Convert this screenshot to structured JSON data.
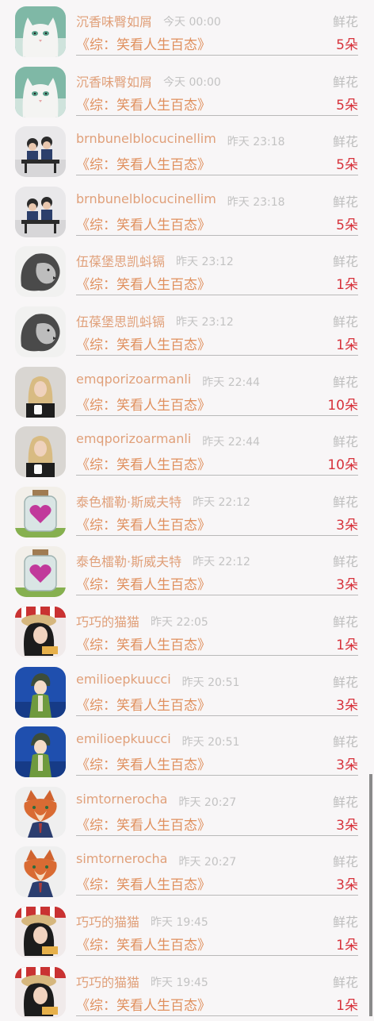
{
  "rows": [
    {
      "name": "沉香味臀如屑",
      "time": "今天 00:00",
      "gift": "鲜花",
      "book": "《综：笑看人生百态》",
      "count": "5朵",
      "avatar": "white-cat"
    },
    {
      "name": "沉香味臀如屑",
      "time": "今天 00:00",
      "gift": "鲜花",
      "book": "《综：笑看人生百态》",
      "count": "5朵",
      "avatar": "white-cat"
    },
    {
      "name": "brnbunelblocucinellim",
      "time": "昨天 23:18",
      "gift": "鲜花",
      "book": "《综：笑看人生百态》",
      "count": "5朵",
      "avatar": "kids-classroom"
    },
    {
      "name": "brnbunelblocucinellim",
      "time": "昨天 23:18",
      "gift": "鲜花",
      "book": "《综：笑看人生百态》",
      "count": "5朵",
      "avatar": "kids-classroom"
    },
    {
      "name": "伍葆堡思凯蚪镉",
      "time": "昨天 23:12",
      "gift": "鲜花",
      "book": "《综：笑看人生百态》",
      "count": "1朵",
      "avatar": "lion-sketch"
    },
    {
      "name": "伍葆堡思凯蚪镉",
      "time": "昨天 23:12",
      "gift": "鲜花",
      "book": "《综：笑看人生百态》",
      "count": "1朵",
      "avatar": "lion-sketch"
    },
    {
      "name": "emqporizoarmanli",
      "time": "昨天 22:44",
      "gift": "鲜花",
      "book": "《综：笑看人生百态》",
      "count": "10朵",
      "avatar": "blonde-woman"
    },
    {
      "name": "emqporizoarmanli",
      "time": "昨天 22:44",
      "gift": "鲜花",
      "book": "《综：笑看人生百态》",
      "count": "10朵",
      "avatar": "blonde-woman"
    },
    {
      "name": "泰色檑勒·斯威夫特",
      "time": "昨天 22:12",
      "gift": "鲜花",
      "book": "《综：笑看人生百态》",
      "count": "3朵",
      "avatar": "heart-jar"
    },
    {
      "name": "泰色檑勒·斯威夫特",
      "time": "昨天 22:12",
      "gift": "鲜花",
      "book": "《综：笑看人生百态》",
      "count": "3朵",
      "avatar": "heart-jar"
    },
    {
      "name": "巧巧的猫猫",
      "time": "昨天 22:05",
      "gift": "鲜花",
      "book": "《综：笑看人生百态》",
      "count": "1朵",
      "avatar": "woman-hat"
    },
    {
      "name": "emilioepkuucci",
      "time": "昨天 20:51",
      "gift": "鲜花",
      "book": "《综：笑看人生百态》",
      "count": "3朵",
      "avatar": "anime-boy"
    },
    {
      "name": "emilioepkuucci",
      "time": "昨天 20:51",
      "gift": "鲜花",
      "book": "《综：笑看人生百态》",
      "count": "3朵",
      "avatar": "anime-boy"
    },
    {
      "name": "simtornerocha",
      "time": "昨天 20:27",
      "gift": "鲜花",
      "book": "《综：笑看人生百态》",
      "count": "3朵",
      "avatar": "fox-cartoon"
    },
    {
      "name": "simtornerocha",
      "time": "昨天 20:27",
      "gift": "鲜花",
      "book": "《综：笑看人生百态》",
      "count": "3朵",
      "avatar": "fox-cartoon"
    },
    {
      "name": "巧巧的猫猫",
      "time": "昨天 19:45",
      "gift": "鲜花",
      "book": "《综：笑看人生百态》",
      "count": "1朵",
      "avatar": "woman-hat"
    },
    {
      "name": "巧巧的猫猫",
      "time": "昨天 19:45",
      "gift": "鲜花",
      "book": "《综：笑看人生百态》",
      "count": "1朵",
      "avatar": "woman-hat"
    }
  ]
}
